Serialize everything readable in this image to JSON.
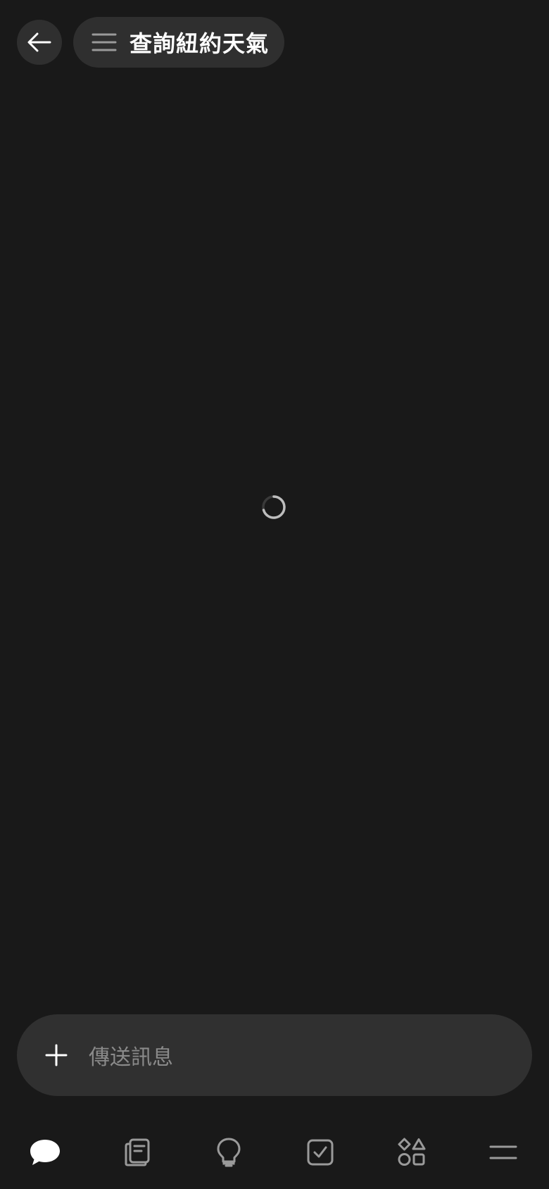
{
  "header": {
    "back_icon": "arrow-left-icon",
    "menu_icon": "hamburger-icon",
    "title": "查詢紐約天氣"
  },
  "main": {
    "loading_icon": "loading-spinner-icon"
  },
  "composer": {
    "add_icon": "plus-icon",
    "placeholder": "傳送訊息"
  },
  "bottom_nav": {
    "items": [
      {
        "icon": "chat-bubble-icon",
        "active": true
      },
      {
        "icon": "notes-icon",
        "active": false
      },
      {
        "icon": "lightbulb-icon",
        "active": false
      },
      {
        "icon": "checkbox-icon",
        "active": false
      },
      {
        "icon": "shapes-icon",
        "active": false
      },
      {
        "icon": "menu-lines-icon",
        "active": false
      }
    ]
  },
  "colors": {
    "background": "#191919",
    "surface": "#2f2f2f",
    "icon_inactive": "#9a9a9a",
    "text_primary": "#ffffff",
    "placeholder": "#8a8a8a"
  }
}
